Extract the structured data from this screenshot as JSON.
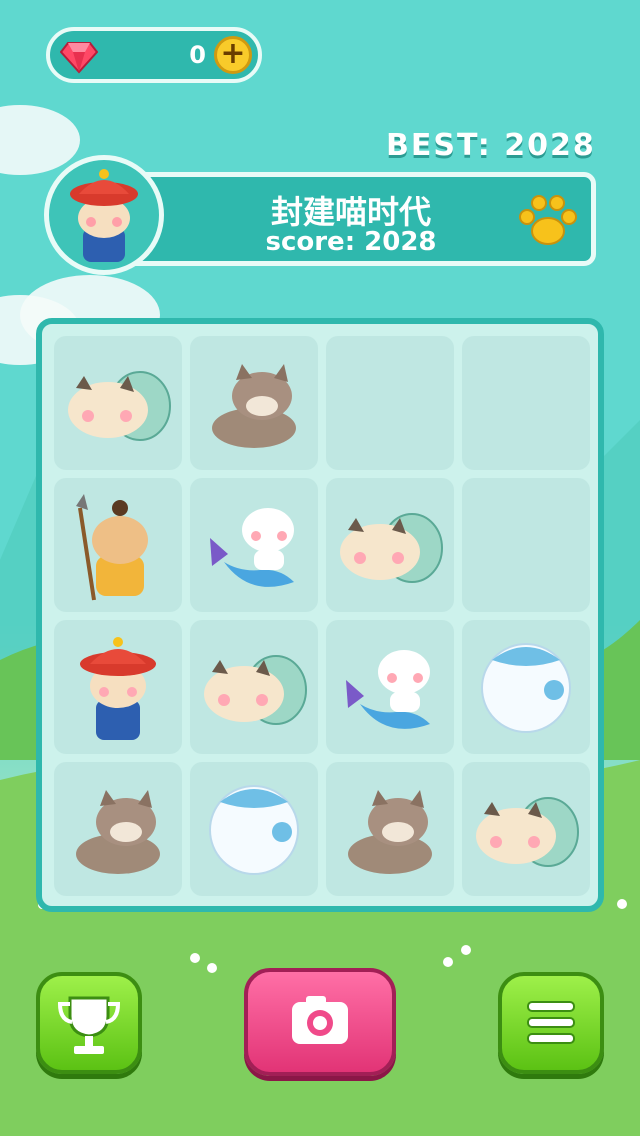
{
  "gems": {
    "count": "0",
    "gem_icon": "ruby-gem-icon",
    "add_icon": "plus-icon"
  },
  "best": {
    "label": "BEST: 2028"
  },
  "header": {
    "title": "封建喵时代",
    "score": "score: 2028",
    "avatar": "qing-official-cat-avatar",
    "paw_icon": "paw-icon"
  },
  "board": {
    "rows": [
      [
        "snail-cat",
        "brown-cat",
        "empty",
        "empty"
      ],
      [
        "caveman-cat",
        "mermaid-cat",
        "snail-cat",
        "empty"
      ],
      [
        "qing-official-cat",
        "snail-cat",
        "mermaid-cat",
        "ball-cat"
      ],
      [
        "brown-cat",
        "ball-cat",
        "brown-cat",
        "snail-cat"
      ]
    ]
  },
  "buttons": {
    "leaderboard_icon": "trophy-icon",
    "camera_icon": "camera-icon",
    "menu_icon": "menu-icon"
  },
  "colors": {
    "accent": "#2fb8ad",
    "board_bg": "#cdf2ec",
    "green_button": "#6cd424",
    "pink_button": "#f04a8a"
  }
}
